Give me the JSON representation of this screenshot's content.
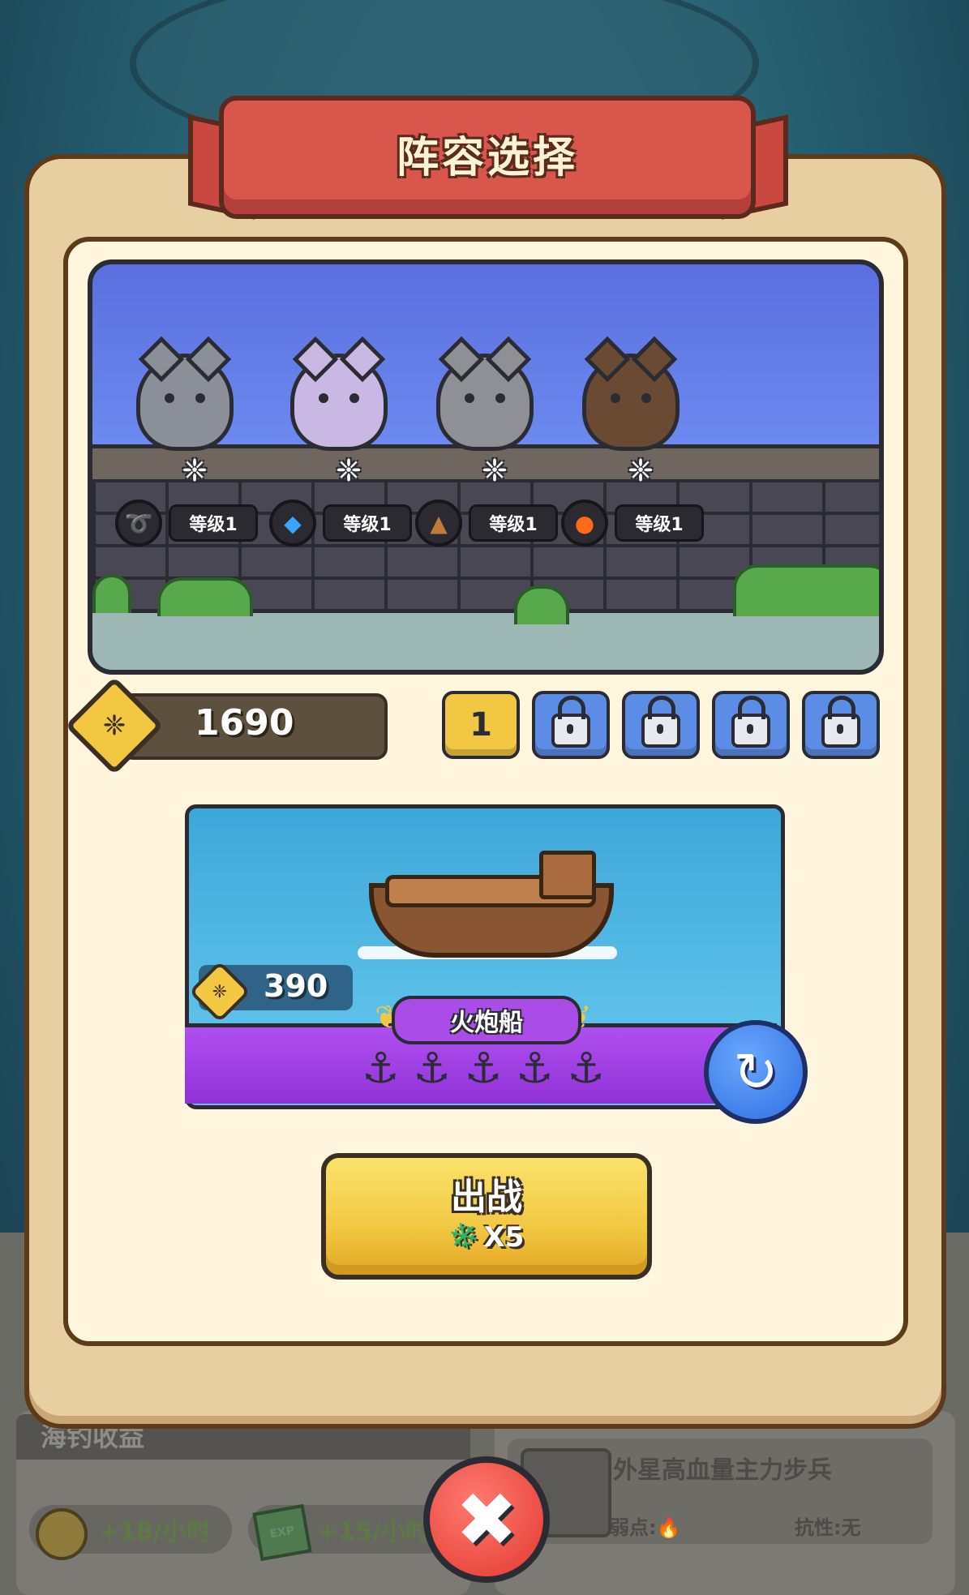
{
  "title": "阵容选择",
  "heroes": [
    {
      "element": "wind",
      "element_glyph": "➰",
      "element_color": "#7fe05a",
      "level": "等级1",
      "color": "#8a8f98"
    },
    {
      "element": "water",
      "element_glyph": "◆",
      "element_color": "#3aa5ff",
      "level": "等级1",
      "color": "#c9b7e4"
    },
    {
      "element": "earth",
      "element_glyph": "▲",
      "element_color": "#c07a3a",
      "level": "等级1",
      "color": "#8f8f96"
    },
    {
      "element": "fire",
      "element_glyph": "●",
      "element_color": "#ff6a1a",
      "level": "等级1",
      "color": "#6a4a32"
    }
  ],
  "paw_glyph": "❈",
  "currency": {
    "value": "1690"
  },
  "team_slots": [
    {
      "label": "1",
      "locked": false
    },
    {
      "label": "",
      "locked": true
    },
    {
      "label": "",
      "locked": true
    },
    {
      "label": "",
      "locked": true
    },
    {
      "label": "",
      "locked": true
    }
  ],
  "ship": {
    "price": "390",
    "name": "火炮船",
    "anchor_glyph": "⚓",
    "anchor_count": 5
  },
  "refresh_icon": "↻",
  "battle_button": {
    "label": "出战",
    "cost": "X5",
    "energy_icon": "❄"
  },
  "income": {
    "title": "海钓收益",
    "coin_rate": "+18/小时",
    "exp_label": "EXP",
    "exp_rate": "+15/小时"
  },
  "enemy": {
    "name": "外星高血量主力步兵",
    "weakness": "弱点:",
    "weakness_icon": "🔥",
    "resistance": "抗性:无"
  },
  "close_icon": "✖",
  "colors": {
    "panel": "#e8cfa2",
    "banner": "#d9564c",
    "gold": "#f2c742",
    "lock_blue": "#5b8de6",
    "purple": "#a94ce8"
  }
}
